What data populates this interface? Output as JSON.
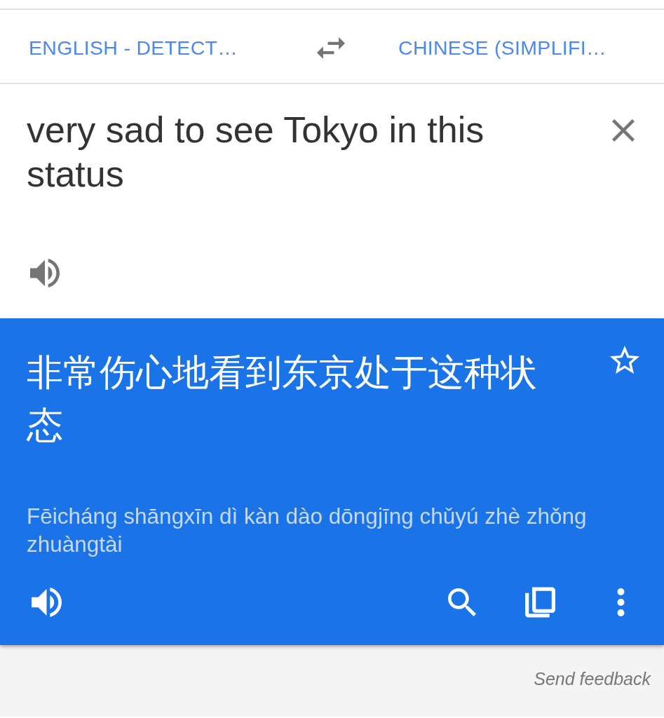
{
  "language_bar": {
    "source_language": "ENGLISH - DETECT…",
    "target_language": "CHINESE (SIMPLIFI…"
  },
  "input": {
    "text": "very sad to see Tokyo in this status"
  },
  "translation": {
    "text": "非常伤心地看到东京处于这种状态",
    "starred": false,
    "romanization": "Fēicháng shāngxīn dì kàn dào dōngjīng chǔyú zhè zhǒng zhuàngtài"
  },
  "footer": {
    "link": "Send feedback"
  }
}
